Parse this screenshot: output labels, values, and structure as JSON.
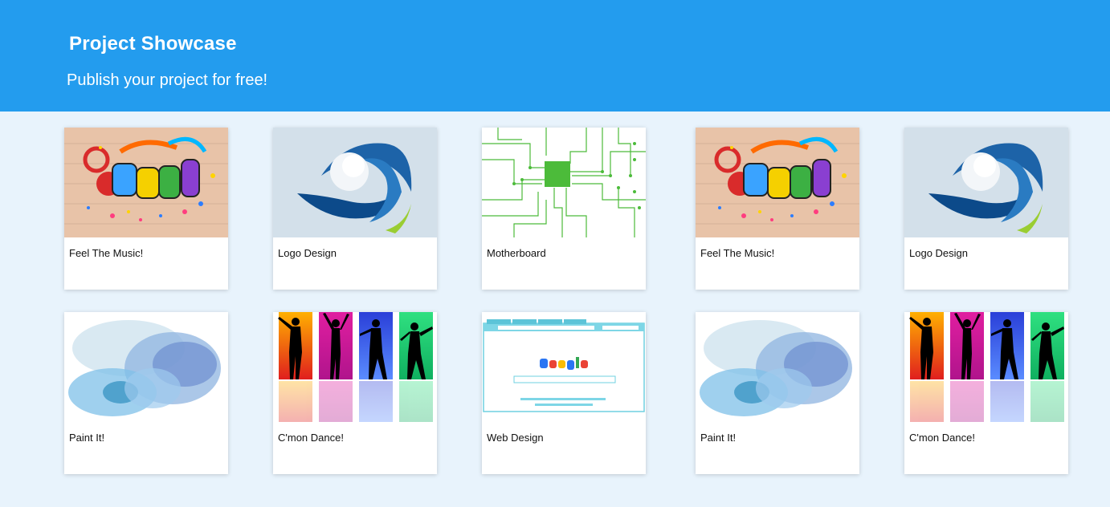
{
  "header": {
    "title": "Project Showcase",
    "subtitle": "Publish your project for free!"
  },
  "projects": [
    {
      "label": "Feel The Music!",
      "image": "music-graffiti-image"
    },
    {
      "label": "Logo Design",
      "image": "blue-swirl-logo-image"
    },
    {
      "label": "Motherboard",
      "image": "circuit-board-image"
    },
    {
      "label": "Feel The Music!",
      "image": "music-graffiti-image"
    },
    {
      "label": "Logo Design",
      "image": "blue-swirl-logo-image"
    },
    {
      "label": "Paint It!",
      "image": "watercolor-splash-image"
    },
    {
      "label": "C'mon Dance!",
      "image": "dancers-silhouette-image"
    },
    {
      "label": "Web Design",
      "image": "browser-mockup-image"
    },
    {
      "label": "Paint It!",
      "image": "watercolor-splash-image"
    },
    {
      "label": "C'mon Dance!",
      "image": "dancers-silhouette-image"
    }
  ],
  "colors": {
    "header_bg": "#239cee",
    "page_bg": "#e8f3fc",
    "card_bg": "#ffffff"
  }
}
